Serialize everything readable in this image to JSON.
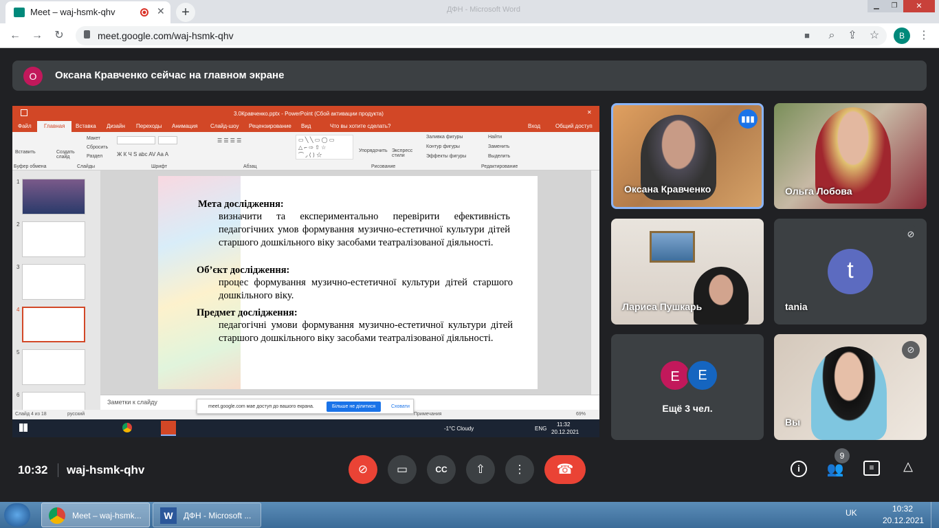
{
  "browser": {
    "tab_title": "Meet – waj-hsmk-qhv",
    "url": "meet.google.com/waj-hsmk-qhv",
    "bg_window_title": "ДФН - Microsoft Word",
    "profile_initial": "B"
  },
  "meet": {
    "banner_initial": "О",
    "banner_text": "Оксана Кравченко сейчас на главном экране",
    "time": "10:32",
    "meeting_code": "waj-hsmk-qhv",
    "participant_count": "9",
    "participants": [
      {
        "name": "Оксана Кравченко"
      },
      {
        "name": "Ольга Лобова"
      },
      {
        "name": "Лариса Пушкарь"
      },
      {
        "name": "tania",
        "initial": "t"
      },
      {
        "name": "Ещё 3 чел.",
        "initials": [
          "E",
          "E"
        ]
      },
      {
        "name": "Вы"
      }
    ],
    "colors": {
      "end_call": "#ea4335",
      "speaking": "#1a73e8",
      "avatar_t": "#5c6bc0",
      "avatar_e1": "#c2185b",
      "avatar_e2": "#1565c0"
    }
  },
  "ppt": {
    "window_title": "3.0Кравченко.pptx - PowerPoint (Сбой активации продукта)",
    "menu": [
      "Файл",
      "Главная",
      "Вставка",
      "Дизайн",
      "Переходы",
      "Анимация",
      "Слайд-шоу",
      "Рецензирование",
      "Вид"
    ],
    "tell_me": "Что вы хотите сделать?",
    "signin": "Вход",
    "share": "Общий доступ",
    "groups": [
      "Буфер обмена",
      "Слайды",
      "Шрифт",
      "Абзац",
      "Рисование",
      "Редактирование"
    ],
    "ribbon_labels": {
      "paste": "Вставить",
      "create_slide": "Создать слайд",
      "layout": "Макет",
      "reset": "Сбросить",
      "section": "Раздел",
      "arrange": "Упорядочить",
      "express": "Экспресс стили",
      "fill": "Заливка фигуры",
      "outline": "Контур фигуры",
      "effects": "Эффекты фигуры",
      "find": "Найти",
      "replace": "Заменить",
      "select": "Выделить"
    },
    "slide": {
      "heading1": "Мета дослідження:",
      "body1": "визначити та експериментально перевірити ефективність педагогічних умов формування музично-естетичної культури дітей старшого дошкільного віку засобами театралізованої діяльності.",
      "heading2": "Об’єкт дослідження:",
      "body2": "процес формування музично-естетичної культури дітей старшого дошкільного віку.",
      "heading3": "Предмет дослідження:",
      "body3": "педагогічні умови формування музично-естетичної культури дітей старшого дошкільного віку засобами театралізованої діяльності."
    },
    "thumb_numbers": [
      "1",
      "2",
      "3",
      "4",
      "5",
      "6"
    ],
    "notes_placeholder": "Заметки к слайду",
    "status_slide": "Слайд 4 из 18",
    "status_lang": "русский",
    "status_notes": "Примечания",
    "zoom": "69%",
    "share_bar_text": "meet.google.com мае доступ до вашого екрана.",
    "share_bar_stop": "Більше не ділитися",
    "share_bar_hide": "Сховати",
    "inner_taskbar": {
      "weather": "-1°C  Cloudy",
      "lang": "ENG",
      "time": "11:32",
      "date": "20.12.2021"
    }
  },
  "taskbar": {
    "chrome_item": "Meet – waj-hsmk...",
    "word_item": "ДФН - Microsoft ...",
    "lang": "UK",
    "time": "10:32",
    "date": "20.12.2021"
  }
}
